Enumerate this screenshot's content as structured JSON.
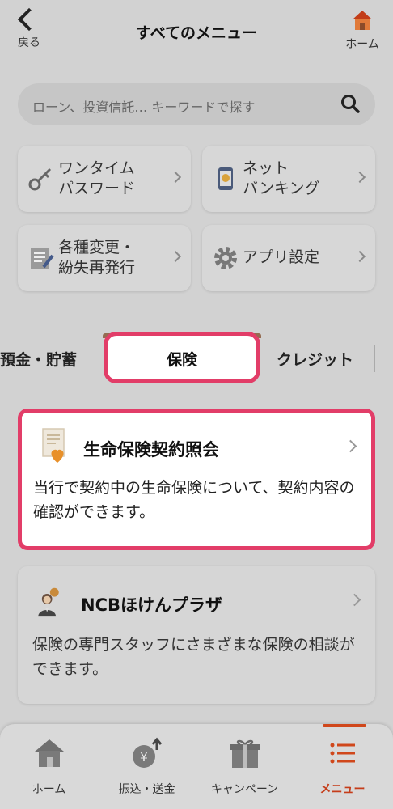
{
  "header": {
    "back_label": "戻る",
    "title": "すべてのメニュー",
    "home_label": "ホーム"
  },
  "search": {
    "placeholder": "ローン、投資信託… キーワードで探す"
  },
  "tiles": [
    {
      "label": "ワンタイム\nパスワード",
      "icon": "key-icon"
    },
    {
      "label": "ネット\nバンキング",
      "icon": "smartphone-yen-icon"
    },
    {
      "label": "各種変更・\n紛失再発行",
      "icon": "document-pen-icon"
    },
    {
      "label": "アプリ設定",
      "icon": "gear-icon"
    }
  ],
  "tabs": {
    "left": "預金・貯蓄",
    "active": "保険",
    "right": "クレジット"
  },
  "cards": [
    {
      "title": "生命保険契約照会",
      "description": "当行で契約中の生命保険について、契約内容の確認ができます。",
      "icon": "insurance-document-icon"
    },
    {
      "title": "NCBほけんプラザ",
      "description": "保険の専門スタッフにさまざまな保険の相談ができます。",
      "icon": "consultant-icon"
    }
  ],
  "bottom_nav": [
    {
      "label": "ホーム",
      "icon": "home-icon"
    },
    {
      "label": "振込・送金",
      "icon": "yen-transfer-icon"
    },
    {
      "label": "キャンペーン",
      "icon": "gift-icon"
    },
    {
      "label": "メニュー",
      "icon": "menu-list-icon",
      "active": true
    }
  ],
  "colors": {
    "accent_pink": "#e23d68",
    "accent_orange": "#d0471b",
    "overlay_gray": "#d2d2d2"
  }
}
